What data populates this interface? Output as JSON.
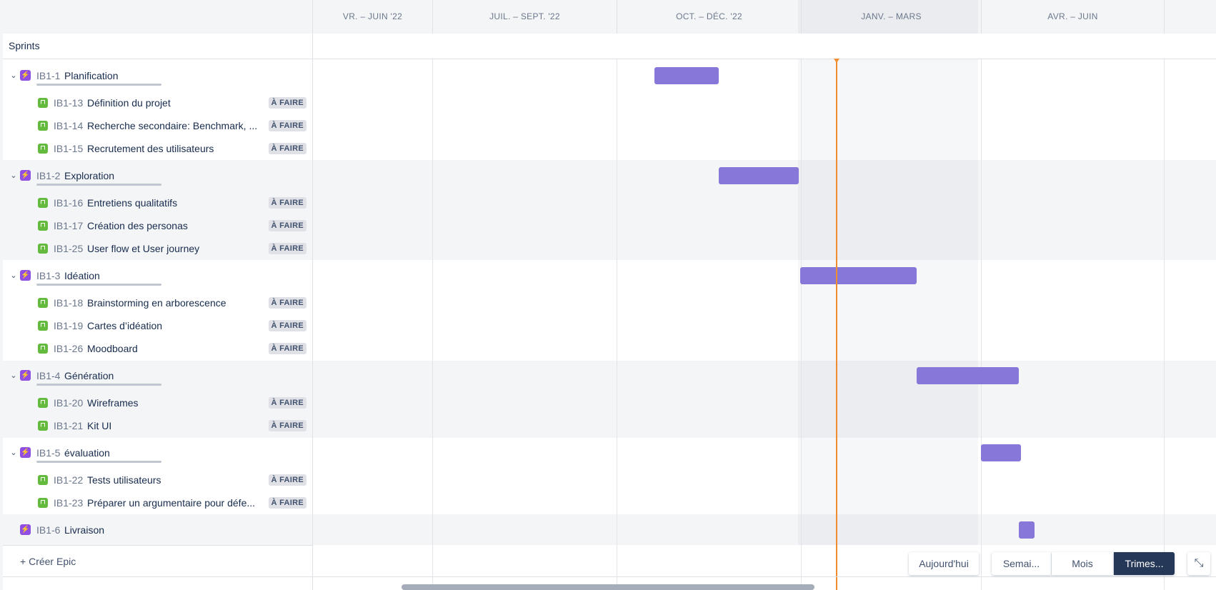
{
  "header": {
    "quarters": [
      "VR. – JUIN '22",
      "JUIL. – SEPT. '22",
      "OCT. – DÉC. '22",
      "JANV. – MARS",
      "AVR. – JUIN"
    ]
  },
  "sprints_label": "Sprints",
  "epics": [
    {
      "key": "IB1-1",
      "title": "Planification",
      "stories": [
        {
          "key": "IB1-13",
          "title": "Définition du projet",
          "status": "À FAIRE"
        },
        {
          "key": "IB1-14",
          "title": "Recherche secondaire: Benchmark, ...",
          "status": "À FAIRE"
        },
        {
          "key": "IB1-15",
          "title": "Recrutement des utilisateurs",
          "status": "À FAIRE"
        }
      ]
    },
    {
      "key": "IB1-2",
      "title": "Exploration",
      "stories": [
        {
          "key": "IB1-16",
          "title": "Entretiens qualitatifs",
          "status": "À FAIRE"
        },
        {
          "key": "IB1-17",
          "title": "Création des personas",
          "status": "À FAIRE"
        },
        {
          "key": "IB1-25",
          "title": "User flow et User journey",
          "status": "À FAIRE"
        }
      ]
    },
    {
      "key": "IB1-3",
      "title": "Idéation",
      "stories": [
        {
          "key": "IB1-18",
          "title": "Brainstorming en arborescence",
          "status": "À FAIRE"
        },
        {
          "key": "IB1-19",
          "title": "Cartes d’idéation",
          "status": "À FAIRE"
        },
        {
          "key": "IB1-26",
          "title": "Moodboard",
          "status": "À FAIRE"
        }
      ]
    },
    {
      "key": "IB1-4",
      "title": "Génération",
      "stories": [
        {
          "key": "IB1-20",
          "title": "Wireframes",
          "status": "À FAIRE"
        },
        {
          "key": "IB1-21",
          "title": "Kit UI",
          "status": "À FAIRE"
        }
      ]
    },
    {
      "key": "IB1-5",
      "title": "évaluation",
      "stories": [
        {
          "key": "IB1-22",
          "title": "Tests utilisateurs",
          "status": "À FAIRE"
        },
        {
          "key": "IB1-23",
          "title": "Préparer un argumentaire pour défe...",
          "status": "À FAIRE"
        }
      ]
    },
    {
      "key": "IB1-6",
      "title": "Livraison",
      "stories": []
    }
  ],
  "create_epic_label": "Créer Epic",
  "controls": {
    "today": "Aujourd'hui",
    "week": "Semai...",
    "month": "Mois",
    "quarter": "Trimes..."
  },
  "colors": {
    "epic_bar": "#8777d9",
    "today_line": "#f08c30",
    "epic_icon": "#904ee2",
    "story_icon": "#63ba3c",
    "active_view": "#253858"
  }
}
